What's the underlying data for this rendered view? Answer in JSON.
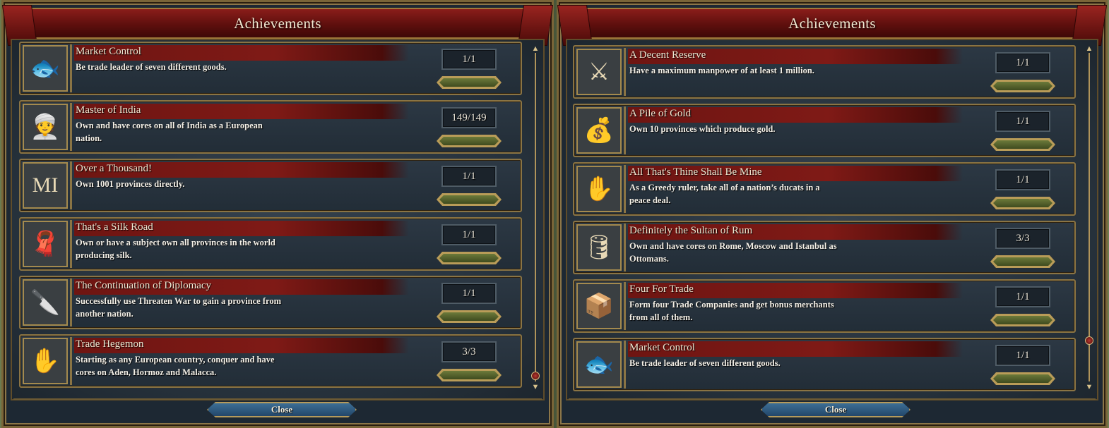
{
  "left_panel": {
    "title": "Achievements",
    "close_label": "Close",
    "items": [
      {
        "name": "Market Control",
        "desc": "Be trade leader of seven different goods.",
        "count": "1/1",
        "progress": 1.0,
        "icon": "fish-trade-icon",
        "glyph": "🐟"
      },
      {
        "name": "Master of India",
        "desc": "Own and have cores on all of India as a European nation.",
        "count": "149/149",
        "progress": 1.0,
        "icon": "turban-icon",
        "glyph": "👳"
      },
      {
        "name": "Over a Thousand!",
        "desc": "Own 1001 provinces directly.",
        "count": "1/1",
        "progress": 1.0,
        "icon": "roman-numeral-mi-icon",
        "glyph": "MI"
      },
      {
        "name": "That's a Silk Road",
        "desc": "Own or have a subject own all provinces in the world producing silk.",
        "count": "1/1",
        "progress": 1.0,
        "icon": "silk-roll-icon",
        "glyph": "🧣"
      },
      {
        "name": "The Continuation of Diplomacy",
        "desc": "Successfully use Threaten War to gain a province from another nation.",
        "count": "1/1",
        "progress": 1.0,
        "icon": "knife-hand-icon",
        "glyph": "🔪"
      },
      {
        "name": "Trade Hegemon",
        "desc": "Starting as any European country, conquer and have cores on Aden, Hormoz and Malacca.",
        "count": "3/3",
        "progress": 1.0,
        "icon": "hand-crate-icon",
        "glyph": "✋"
      }
    ]
  },
  "right_panel": {
    "title": "Achievements",
    "close_label": "Close",
    "items": [
      {
        "name": "A Decent Reserve",
        "desc": "Have a maximum manpower of at least 1 million.",
        "count": "1/1",
        "progress": 1.0,
        "icon": "soldiers-icon",
        "glyph": "⚔"
      },
      {
        "name": "A Pile of Gold",
        "desc": "Own 10 provinces which produce gold.",
        "count": "1/1",
        "progress": 1.0,
        "icon": "gold-pile-icon",
        "glyph": "💰"
      },
      {
        "name": "All That's Thine Shall Be Mine",
        "desc": "As a Greedy ruler, take all of a nation’s ducats in a peace deal.",
        "count": "1/1",
        "progress": 1.0,
        "icon": "greedy-hand-icon",
        "glyph": "✋"
      },
      {
        "name": "Definitely the Sultan of Rum",
        "desc": "Own and have cores on Rome, Moscow and Istanbul as Ottomans.",
        "count": "3/3",
        "progress": 1.0,
        "icon": "barrel-icon",
        "glyph": "🛢"
      },
      {
        "name": "Four For Trade",
        "desc": "Form four Trade Companies and get bonus merchants from all of them.",
        "count": "1/1",
        "progress": 1.0,
        "icon": "trade-crate-shield-icon",
        "glyph": "📦"
      },
      {
        "name": "Market Control",
        "desc": "Be trade leader of seven different goods.",
        "count": "1/1",
        "progress": 1.0,
        "icon": "fish-trade-icon",
        "glyph": "🐟"
      }
    ]
  },
  "colors": {
    "panel_bg": "#1d2833",
    "title_red": "#7f1a16",
    "gold_border": "#8a7444",
    "progress_green": "#5a6a2e",
    "close_blue": "#2f5a80"
  }
}
